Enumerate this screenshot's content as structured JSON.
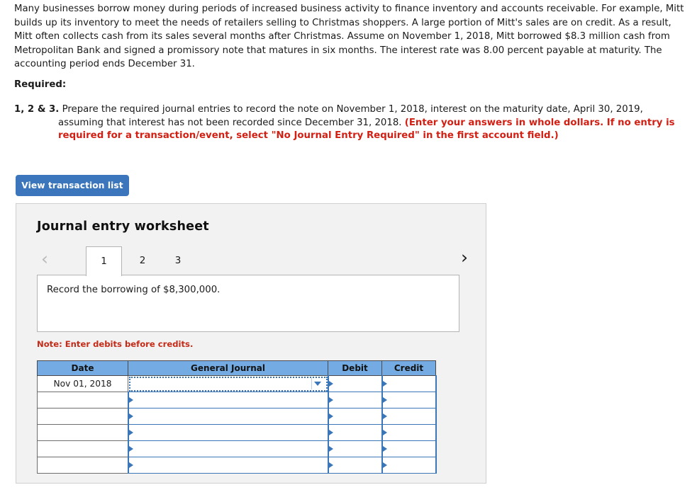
{
  "problem": {
    "intro": "Many businesses borrow money during periods of increased business activity to finance inventory and accounts receivable. For example, Mitt builds up its inventory to meet the needs of retailers selling to Christmas shoppers. A large portion of Mitt's sales are on credit. As a result, Mitt often collects cash from its sales several months after Christmas. Assume on November 1, 2018, Mitt borrowed $8.3 million cash from Metropolitan Bank and signed a promissory note that matures in six months. The interest rate was 8.00 percent payable at maturity. The accounting period ends December 31.",
    "required_label": "Required:",
    "requirement_number": "1, 2 & 3.",
    "requirement_text": " Prepare the required journal entries to record the note on November 1, 2018, interest on the maturity date, April 30, 2019, assuming that interest has not been recorded since December 31, 2018. ",
    "requirement_note": "(Enter your answers in whole dollars. If no entry is required for a transaction/event, select \"No Journal Entry Required\" in the first account field.)"
  },
  "toolbar": {
    "view_transaction_list_label": "View transaction list"
  },
  "worksheet": {
    "title": "Journal entry worksheet",
    "prev_icon": "‹",
    "next_icon": "›",
    "tabs": [
      {
        "label": "1",
        "active": true
      },
      {
        "label": "2",
        "active": false
      },
      {
        "label": "3",
        "active": false
      }
    ],
    "transaction_description": "Record the borrowing of $8,300,000.",
    "note": "Note: Enter debits before credits.",
    "table": {
      "columns": [
        "Date",
        "General Journal",
        "Debit",
        "Credit"
      ],
      "rows": [
        {
          "date": "Nov 01, 2018",
          "general_journal": "",
          "debit": "",
          "credit": "",
          "selected": true
        },
        {
          "date": "",
          "general_journal": "",
          "debit": "",
          "credit": "",
          "selected": false
        },
        {
          "date": "",
          "general_journal": "",
          "debit": "",
          "credit": "",
          "selected": false
        },
        {
          "date": "",
          "general_journal": "",
          "debit": "",
          "credit": "",
          "selected": false
        },
        {
          "date": "",
          "general_journal": "",
          "debit": "",
          "credit": "",
          "selected": false
        },
        {
          "date": "",
          "general_journal": "",
          "debit": "",
          "credit": "",
          "selected": false
        }
      ]
    }
  },
  "colors": {
    "button_blue": "#3b76bd",
    "header_blue": "#74abe2",
    "cell_border_blue": "#3a76b8",
    "note_red": "#c52a17",
    "instruction_red": "#d21f13",
    "panel_gray": "#f2f2f2"
  }
}
